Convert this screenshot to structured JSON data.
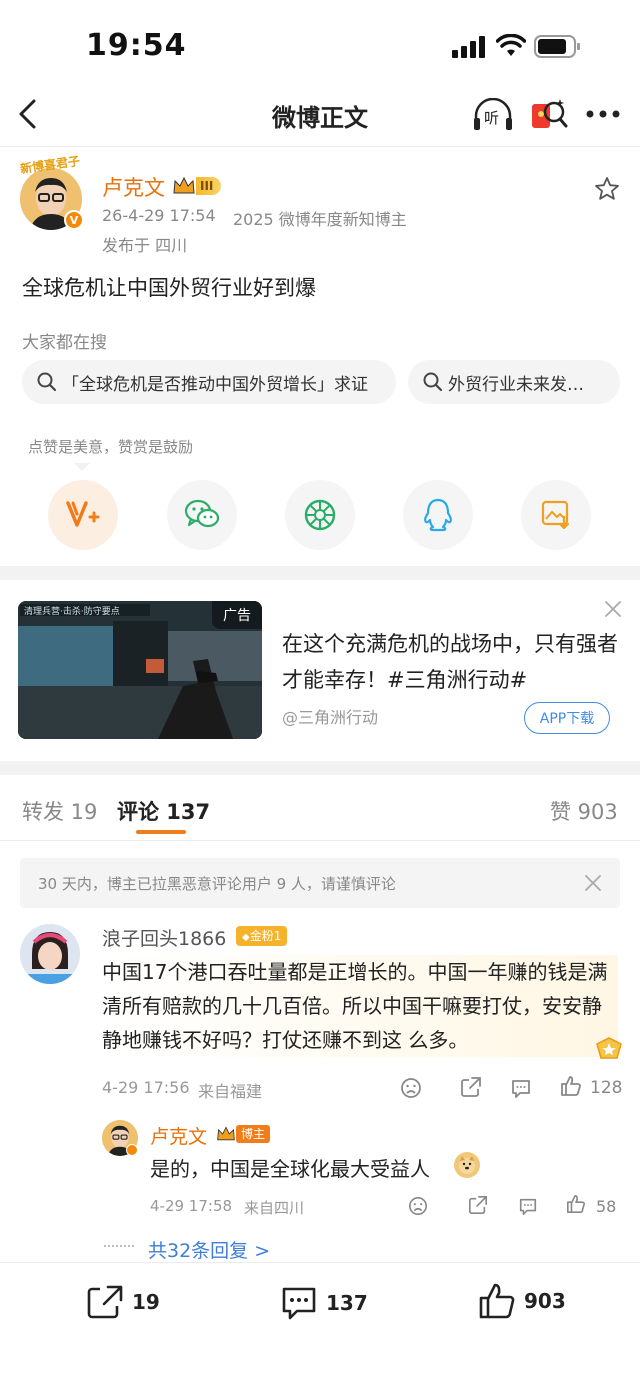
{
  "status_bar": {
    "time": "19:54"
  },
  "nav": {
    "title": "微博正文",
    "listen_label": "听"
  },
  "author": {
    "name": "卢克文",
    "level": "III",
    "avatar_tag": "新博喜君子",
    "date": "26-4-29 17:54",
    "honor": "2025 微博年度新知博主",
    "location": "发布于 四川"
  },
  "post": {
    "text": "全球危机让中国外贸行业好到爆"
  },
  "hot_search": {
    "label": "大家都在搜",
    "items": [
      "「全球危机是否推动中国外贸增长」求证",
      "外贸行业未来发…"
    ]
  },
  "reward": {
    "hint": "点赞是美意，赞赏是鼓励"
  },
  "share_icons": [
    "reward-v-icon",
    "wechat-icon",
    "moments-icon",
    "qq-icon",
    "save-image-icon"
  ],
  "ad": {
    "badge": "广告",
    "image_caption": "清理兵营·击杀·防守要点",
    "text": "在这个充满危机的战场中，只有强者才能幸存！#三角洲行动#",
    "source": "@三角洲行动",
    "button": "APP下载"
  },
  "tabs": {
    "repost": "转发 19",
    "comment": "评论 137",
    "like": "赞 903"
  },
  "notice": "30 天内，博主已拉黑恶意评论用户 9 人，请谨慎评论",
  "comment": {
    "user": "浪子回头1866",
    "badge": "金粉1",
    "text": "中国17个港口吞吐量都是正增长的。中国一年赚的钱是满清所有赔款的几十几百倍。所以中国干嘛要打仗，安安静静地赚钱不好吗？打仗还赚不到这 么多。",
    "time": "4-29 17:56",
    "from": "来自福建",
    "likes": "128"
  },
  "reply": {
    "user": "卢克文",
    "badge": "博主",
    "text": "是的，中国是全球化最大受益人",
    "time": "4-29 17:58",
    "from": "来自四川",
    "likes": "58"
  },
  "more_replies": "共32条回复 >",
  "bottom_bar": {
    "reposts": "19",
    "comments": "137",
    "likes": "903"
  },
  "colors": {
    "accent": "#e8710a",
    "link": "#3f8ce6",
    "wechat": "#2aae67",
    "qq": "#29a9e8",
    "gold": "#f0a020"
  }
}
